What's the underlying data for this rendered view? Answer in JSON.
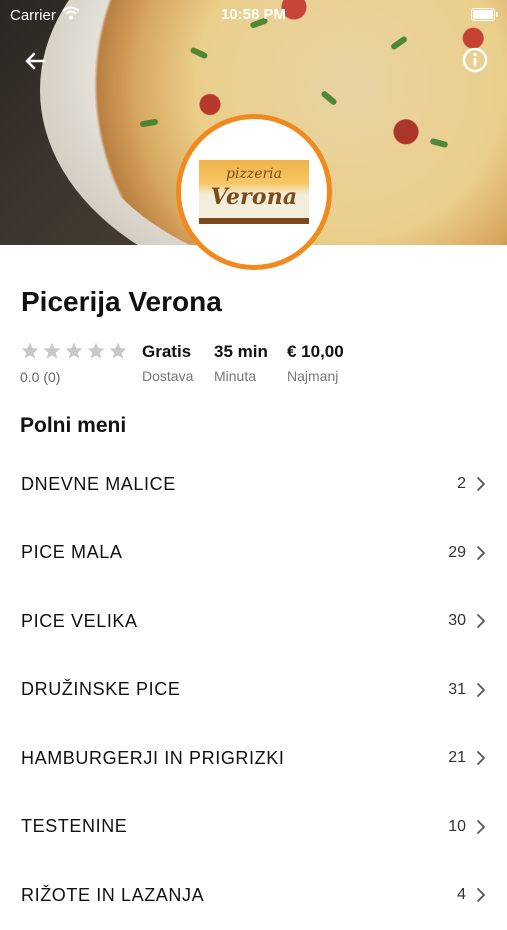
{
  "statusbar": {
    "carrier": "Carrier",
    "time": "10:58 PM"
  },
  "header": {
    "logo_line1": "pizzeria",
    "logo_line2": "Verona"
  },
  "restaurant": {
    "name": "Picerija Verona",
    "rating_text": "0.0 (0)",
    "rating_value": 0,
    "stats": [
      {
        "value": "Gratis",
        "label": "Dostava"
      },
      {
        "value": "35 min",
        "label": "Minuta"
      },
      {
        "value": "€ 10,00",
        "label": "Najmanj"
      }
    ]
  },
  "menu": {
    "title": "Polni meni",
    "items": [
      {
        "name": "DNEVNE MALICE",
        "count": "2"
      },
      {
        "name": "PICE MALA",
        "count": "29"
      },
      {
        "name": "PICE VELIKA",
        "count": "30"
      },
      {
        "name": "DRUŽINSKE PICE",
        "count": "31"
      },
      {
        "name": "HAMBURGERJI IN PRIGRIZKI",
        "count": "21"
      },
      {
        "name": "TESTENINE",
        "count": "10"
      },
      {
        "name": "RIŽOTE IN LAZANJA",
        "count": "4"
      }
    ]
  },
  "colors": {
    "accent": "#f08a1e",
    "star": "#c9c9c9"
  }
}
